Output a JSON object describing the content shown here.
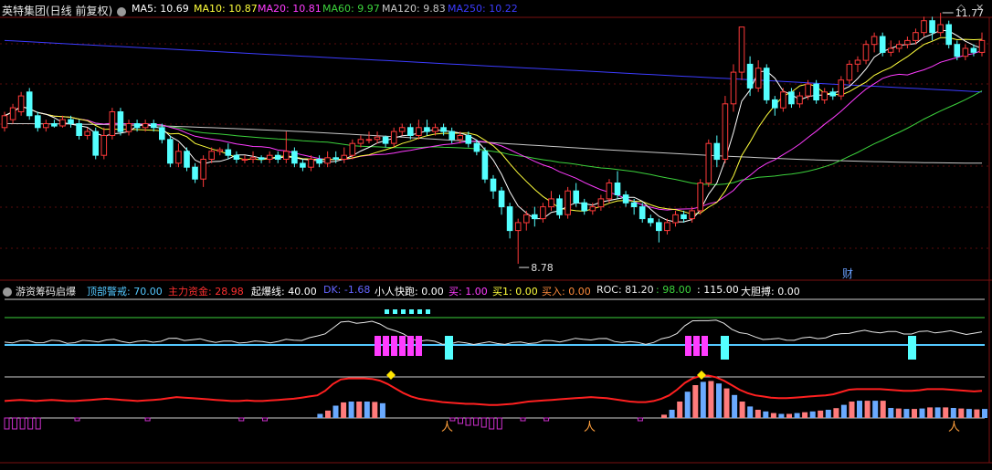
{
  "main_header": {
    "title": "英特集团(日线 前复权)",
    "ma5": "MA5: 10.69",
    "ma10": "MA10: 10.87",
    "ma20": "MA20: 10.81",
    "ma60": "MA60: 9.97",
    "ma120": "MA120: 9.83",
    "ma250": "MA250: 10.22"
  },
  "sub_header": {
    "title": "游资筹码启爆",
    "f1": "顶部警戒: 70.00",
    "f2": "主力资金: 28.98",
    "f3": "起爆线: 40.00",
    "f4": "DK: -1.68",
    "f5": "小人快跑: 0.00",
    "f6": "买: 1.00",
    "f7": "买1: 0.00",
    "f8": "买入: 0.00",
    "f9": "ROC: 81.20",
    "f10": ": 98.00",
    "f11": ": 115.00",
    "f12": "大胆搏: 0.00"
  },
  "chart_data": {
    "type": "candlestick",
    "annotations": {
      "high": "11.77",
      "low": "8.78",
      "badge": "财"
    },
    "colors": {
      "up": "#ff3a3a",
      "down": "#54ffff",
      "ma5": "#ffffff",
      "ma10": "#ffff3c",
      "ma20": "#ff3cff",
      "ma60": "#3cd23c",
      "ma120": "#c8c8c8",
      "ma250": "#3c3cff"
    },
    "candles": [
      [
        10.5,
        10.65,
        10.45,
        10.7
      ],
      [
        10.6,
        10.75,
        10.55,
        10.8
      ],
      [
        10.7,
        10.9,
        10.65,
        10.95
      ],
      [
        10.95,
        10.65,
        10.6,
        11.0
      ],
      [
        10.65,
        10.5,
        10.45,
        10.7
      ],
      [
        10.5,
        10.55,
        10.45,
        10.6
      ],
      [
        10.55,
        10.52,
        10.5,
        10.6
      ],
      [
        10.52,
        10.6,
        10.5,
        10.65
      ],
      [
        10.6,
        10.55,
        10.5,
        10.65
      ],
      [
        10.55,
        10.4,
        10.35,
        10.6
      ],
      [
        10.4,
        10.45,
        10.35,
        10.5
      ],
      [
        10.45,
        10.15,
        10.1,
        10.5
      ],
      [
        10.15,
        10.4,
        10.1,
        10.5
      ],
      [
        10.4,
        10.7,
        10.35,
        10.75
      ],
      [
        10.7,
        10.45,
        10.4,
        10.75
      ],
      [
        10.45,
        10.55,
        10.4,
        10.6
      ],
      [
        10.55,
        10.5,
        10.45,
        10.6
      ],
      [
        10.5,
        10.55,
        10.45,
        10.6
      ],
      [
        10.55,
        10.5,
        10.45,
        10.6
      ],
      [
        10.5,
        10.35,
        10.3,
        10.55
      ],
      [
        10.35,
        10.05,
        10.0,
        10.4
      ],
      [
        10.05,
        10.2,
        10.0,
        10.3
      ],
      [
        10.2,
        10.0,
        9.95,
        10.25
      ],
      [
        10.0,
        9.85,
        9.8,
        10.05
      ],
      [
        9.85,
        10.1,
        9.75,
        10.15
      ],
      [
        10.1,
        10.2,
        10.05,
        10.25
      ],
      [
        10.2,
        10.22,
        10.15,
        10.25
      ],
      [
        10.22,
        10.15,
        10.1,
        10.3
      ],
      [
        10.15,
        10.1,
        10.05,
        10.2
      ],
      [
        10.1,
        10.1,
        10.05,
        10.15
      ],
      [
        10.1,
        10.12,
        10.05,
        10.2
      ],
      [
        10.12,
        10.1,
        10.05,
        10.15
      ],
      [
        10.1,
        10.15,
        10.05,
        10.2
      ],
      [
        10.15,
        10.1,
        10.05,
        10.2
      ],
      [
        10.1,
        10.2,
        10.05,
        10.45
      ],
      [
        10.2,
        10.05,
        10.0,
        10.25
      ],
      [
        10.05,
        10.0,
        9.95,
        10.1
      ],
      [
        10.0,
        10.1,
        9.95,
        10.15
      ],
      [
        10.1,
        10.05,
        10.0,
        10.15
      ],
      [
        10.05,
        10.12,
        10.0,
        10.2
      ],
      [
        10.12,
        10.1,
        10.05,
        10.2
      ],
      [
        10.1,
        10.15,
        10.05,
        10.25
      ],
      [
        10.15,
        10.3,
        10.1,
        10.35
      ],
      [
        10.3,
        10.35,
        10.25,
        10.4
      ],
      [
        10.35,
        10.35,
        10.3,
        10.45
      ],
      [
        10.35,
        10.38,
        10.3,
        10.45
      ],
      [
        10.38,
        10.3,
        10.25,
        10.4
      ],
      [
        10.3,
        10.45,
        10.25,
        10.5
      ],
      [
        10.45,
        10.5,
        10.4,
        10.55
      ],
      [
        10.5,
        10.4,
        10.35,
        10.55
      ],
      [
        10.4,
        10.5,
        10.35,
        10.6
      ],
      [
        10.5,
        10.45,
        10.4,
        10.6
      ],
      [
        10.45,
        10.5,
        10.4,
        10.55
      ],
      [
        10.5,
        10.45,
        10.4,
        10.55
      ],
      [
        10.45,
        10.35,
        10.3,
        10.5
      ],
      [
        10.35,
        10.4,
        10.3,
        10.45
      ],
      [
        10.4,
        10.3,
        10.25,
        10.45
      ],
      [
        10.3,
        10.2,
        10.15,
        10.35
      ],
      [
        10.2,
        9.85,
        9.8,
        10.25
      ],
      [
        9.85,
        9.7,
        9.6,
        9.9
      ],
      [
        9.7,
        9.5,
        9.4,
        9.75
      ],
      [
        9.5,
        9.2,
        9.1,
        9.55
      ],
      [
        9.2,
        9.3,
        8.78,
        9.35
      ],
      [
        9.3,
        9.4,
        9.2,
        9.45
      ],
      [
        9.4,
        9.35,
        9.25,
        9.5
      ],
      [
        9.35,
        9.5,
        9.3,
        9.55
      ],
      [
        9.5,
        9.6,
        9.45,
        9.7
      ],
      [
        9.6,
        9.4,
        9.35,
        9.65
      ],
      [
        9.4,
        9.7,
        9.35,
        9.75
      ],
      [
        9.7,
        9.55,
        9.5,
        9.8
      ],
      [
        9.55,
        9.45,
        9.4,
        9.6
      ],
      [
        9.45,
        9.5,
        9.4,
        9.55
      ],
      [
        9.5,
        9.6,
        9.45,
        9.65
      ],
      [
        9.6,
        9.8,
        9.55,
        9.85
      ],
      [
        9.8,
        9.65,
        9.6,
        9.95
      ],
      [
        9.65,
        9.55,
        9.5,
        9.7
      ],
      [
        9.55,
        9.5,
        9.4,
        9.6
      ],
      [
        9.5,
        9.35,
        9.3,
        9.55
      ],
      [
        9.35,
        9.3,
        9.25,
        9.4
      ],
      [
        9.3,
        9.2,
        9.05,
        9.35
      ],
      [
        9.2,
        9.3,
        9.15,
        9.35
      ],
      [
        9.3,
        9.4,
        9.25,
        9.45
      ],
      [
        9.4,
        9.35,
        9.3,
        9.45
      ],
      [
        9.35,
        9.45,
        9.3,
        9.5
      ],
      [
        9.45,
        9.8,
        9.4,
        9.85
      ],
      [
        9.8,
        10.3,
        9.75,
        10.35
      ],
      [
        10.3,
        10.1,
        10.0,
        10.4
      ],
      [
        10.1,
        10.8,
        10.05,
        10.9
      ],
      [
        10.8,
        11.2,
        10.7,
        11.3
      ],
      [
        11.2,
        11.77,
        11.1,
        11.77
      ],
      [
        11.3,
        11.0,
        10.9,
        11.4
      ],
      [
        11.0,
        11.25,
        10.95,
        11.35
      ],
      [
        11.25,
        10.85,
        10.8,
        11.3
      ],
      [
        10.85,
        10.75,
        10.65,
        10.9
      ],
      [
        10.75,
        10.95,
        10.7,
        11.0
      ],
      [
        10.95,
        10.8,
        10.75,
        11.0
      ],
      [
        10.8,
        10.9,
        10.75,
        10.95
      ],
      [
        10.9,
        11.05,
        10.85,
        11.1
      ],
      [
        11.05,
        10.85,
        10.8,
        11.1
      ],
      [
        10.85,
        10.95,
        10.8,
        11.0
      ],
      [
        10.95,
        10.9,
        10.85,
        11.0
      ],
      [
        10.9,
        11.1,
        10.85,
        11.15
      ],
      [
        11.1,
        11.3,
        11.05,
        11.35
      ],
      [
        11.3,
        11.35,
        11.2,
        11.4
      ],
      [
        11.35,
        11.55,
        11.3,
        11.6
      ],
      [
        11.55,
        11.65,
        11.45,
        11.7
      ],
      [
        11.65,
        11.45,
        11.4,
        11.7
      ],
      [
        11.45,
        11.5,
        11.4,
        11.6
      ],
      [
        11.5,
        11.55,
        11.45,
        11.6
      ],
      [
        11.55,
        11.6,
        11.5,
        11.65
      ],
      [
        11.6,
        11.7,
        11.55,
        11.75
      ],
      [
        11.7,
        11.85,
        11.65,
        11.9
      ],
      [
        11.85,
        11.7,
        11.6,
        11.9
      ],
      [
        11.7,
        11.8,
        11.65,
        11.95
      ],
      [
        11.8,
        11.55,
        11.5,
        11.85
      ],
      [
        11.55,
        11.4,
        11.35,
        11.6
      ],
      [
        11.4,
        11.5,
        11.35,
        11.55
      ],
      [
        11.5,
        11.45,
        11.4,
        11.55
      ],
      [
        11.45,
        11.6,
        11.4,
        11.7
      ]
    ],
    "ma_levels": {
      "ma120": 10.35,
      "ma250_start": 11.6,
      "ma250_end": 10.95
    },
    "indicator": {
      "roc_line": [
        30,
        31,
        32,
        31,
        30,
        31,
        32,
        31,
        30,
        30,
        31,
        32,
        33,
        34,
        33,
        32,
        31,
        30,
        31,
        32,
        33,
        35,
        37,
        36,
        35,
        34,
        33,
        32,
        31,
        30,
        30,
        31,
        30,
        30,
        31,
        32,
        33,
        34,
        36,
        38,
        40,
        48,
        60,
        68,
        70,
        70,
        70,
        69,
        66,
        60,
        52,
        44,
        38,
        34,
        32,
        30,
        28,
        27,
        26,
        25,
        25,
        24,
        23,
        23,
        24,
        25,
        27,
        29,
        30,
        31,
        32,
        33,
        34,
        35,
        36,
        37,
        36,
        35,
        33,
        31,
        29,
        28,
        28,
        30,
        34,
        40,
        50,
        62,
        70,
        74,
        75,
        72,
        66,
        58,
        50,
        44,
        40,
        38,
        36,
        35,
        35,
        36,
        37,
        38,
        39,
        40,
        42,
        46,
        50,
        51,
        51,
        51,
        51,
        50,
        49,
        48,
        48,
        49,
        51,
        51,
        51,
        50,
        49,
        48,
        47,
        48
      ]
    }
  }
}
